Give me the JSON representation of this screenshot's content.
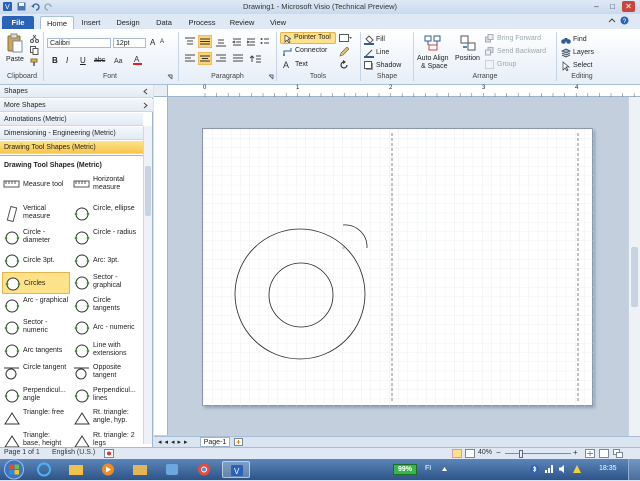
{
  "titlebar": {
    "title": "Drawing1 - Microsoft Visio (Technical Preview)",
    "min": "–",
    "max": "□",
    "close": "✕"
  },
  "tabs": [
    {
      "label": "File"
    },
    {
      "label": "Home"
    },
    {
      "label": "Insert"
    },
    {
      "label": "Design"
    },
    {
      "label": "Data"
    },
    {
      "label": "Process"
    },
    {
      "label": "Review"
    },
    {
      "label": "View"
    }
  ],
  "ribbon": {
    "clipboard": {
      "paste": "Paste",
      "label": "Clipboard"
    },
    "font": {
      "family": "Calibri",
      "size": "12pt",
      "bold": "B",
      "italic": "I",
      "underline": "U",
      "abc": "abc",
      "label": "Font",
      "grow": "A",
      "shrink": "A"
    },
    "paragraph": {
      "label": "Paragraph"
    },
    "tools": {
      "pointer": "Pointer Tool",
      "connector": "Connector",
      "text": "Text",
      "label": "Tools"
    },
    "shape": {
      "fill": "Fill",
      "line": "Line",
      "shadow": "Shadow",
      "label": "Shape"
    },
    "arrange": {
      "auto_align": "Auto Align",
      "auto_align2": "& Space",
      "position": "Position",
      "bring_forward": "Bring Forward",
      "send_backward": "Send Backward",
      "group": "Group",
      "label": "Arrange"
    },
    "editing": {
      "find": "Find",
      "layers": "Layers",
      "select": "Select",
      "label": "Editing"
    }
  },
  "shapes_pane": {
    "header": "Shapes",
    "more": "More Shapes",
    "stencils": [
      "Annotations (Metric)",
      "Dimensioning - Engineering (Metric)",
      "Drawing Tool Shapes (Metric)"
    ],
    "title": "Drawing Tool Shapes (Metric)",
    "items": [
      [
        "Measure tool",
        "Horizontal measure"
      ],
      [
        "Vertical measure",
        "Circle, ellipse"
      ],
      [
        "Circle - diameter",
        "Circle - radius"
      ],
      [
        "Circle 3pt.",
        "Arc: 3pt."
      ],
      [
        "Circles",
        "Sector - graphical"
      ],
      [
        "Arc - graphical",
        "Circle tangents"
      ],
      [
        "Sector - numeric",
        "Arc - numeric"
      ],
      [
        "Arc tangents",
        "Line with extensions"
      ],
      [
        "Circle tangent",
        "Opposite tangent"
      ],
      [
        "Perpendicul... angle",
        "Perpendicul... lines"
      ],
      [
        "Triangle: free",
        "Rt. triangle: angle, hyp."
      ],
      [
        "Triangle: base, height",
        "Rt. triangle: 2 legs"
      ]
    ]
  },
  "ruler_ticks": [
    "0",
    "1",
    "2",
    "3",
    "4"
  ],
  "page_tab": "Page-1",
  "status": {
    "page": "Page 1 of 1",
    "language": "English (U.S.)",
    "zoom": "40%"
  },
  "taskbar": {
    "battery": "99%",
    "lang": "FI",
    "time": "18:35"
  },
  "colors": {
    "file_tab": "#2a62b8",
    "selected_stencil": "#f8c64d",
    "ribbon_bg": "#e6eef8"
  }
}
